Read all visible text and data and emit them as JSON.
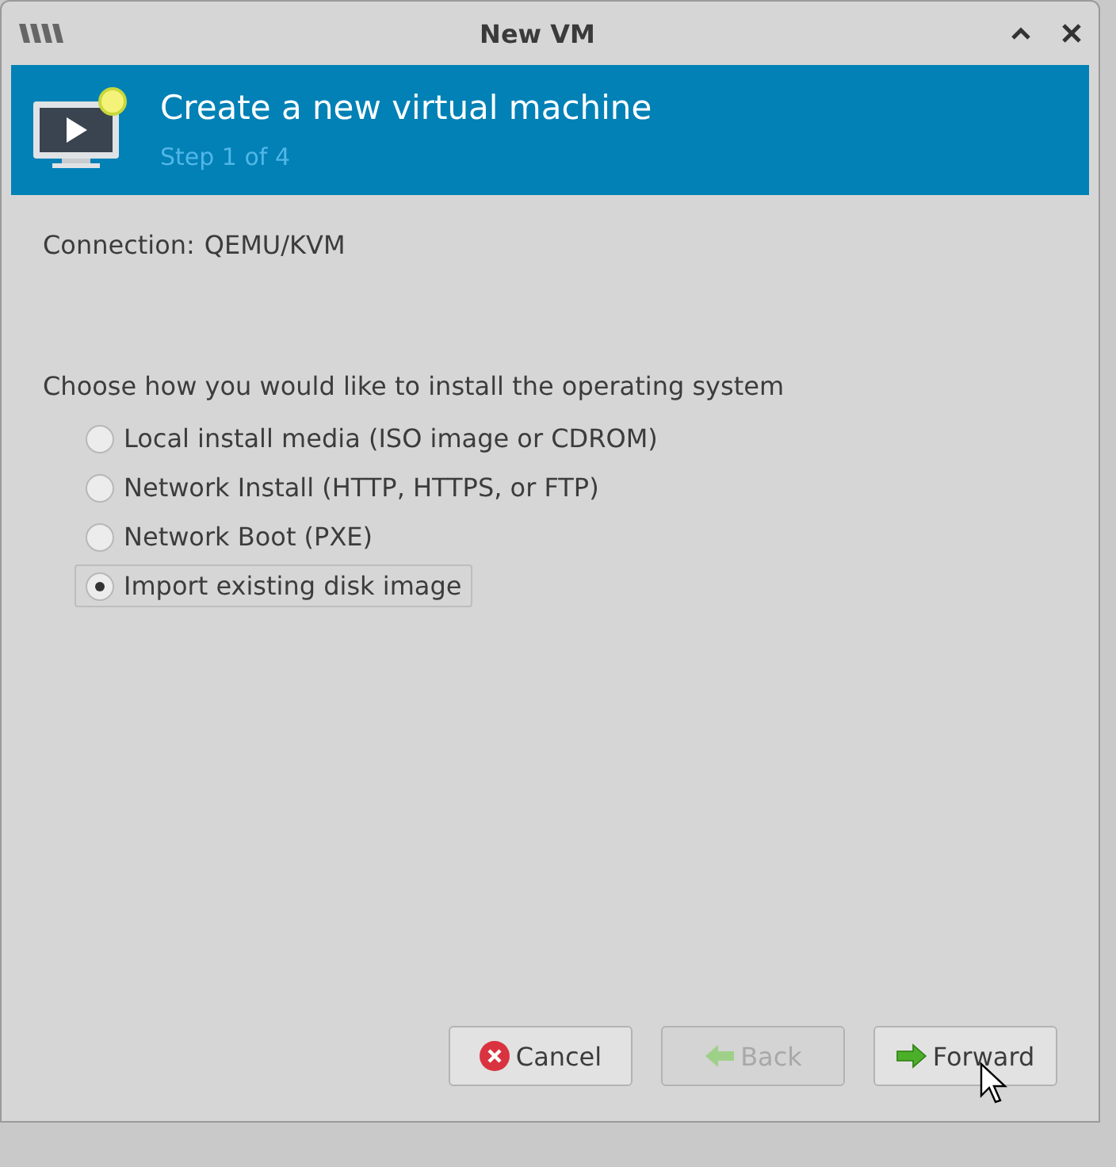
{
  "window": {
    "title": "New VM"
  },
  "header": {
    "title": "Create a new virtual machine",
    "step": "Step 1 of 4"
  },
  "connection": {
    "label": "Connection:",
    "value": "QEMU/KVM"
  },
  "prompt": "Choose how you would like to install the operating system",
  "options": [
    {
      "label": "Local install media (ISO image or CDROM)",
      "selected": false
    },
    {
      "label": "Network Install (HTTP, HTTPS, or FTP)",
      "selected": false
    },
    {
      "label": "Network Boot (PXE)",
      "selected": false
    },
    {
      "label": "Import existing disk image",
      "selected": true
    }
  ],
  "buttons": [
    {
      "label": "Cancel",
      "kind": "cancel",
      "disabled": false
    },
    {
      "label": "Back",
      "kind": "back",
      "disabled": true
    },
    {
      "label": "Forward",
      "kind": "forward",
      "disabled": false
    }
  ]
}
